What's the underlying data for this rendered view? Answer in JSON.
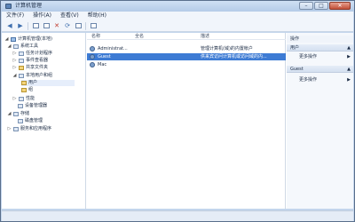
{
  "window": {
    "title": "计算机管理",
    "min_label": "–",
    "max_label": "□",
    "close_label": "✕"
  },
  "menu": [
    "文件(F)",
    "操作(A)",
    "查看(V)",
    "帮助(H)"
  ],
  "toolbar": {
    "icons": [
      "back-icon",
      "forward-icon",
      "properties-icon",
      "list-icon",
      "delete-icon",
      "refresh-icon",
      "export-icon",
      "help-icon"
    ]
  },
  "tree": {
    "root": "计算机管理(本地)",
    "system_tools": "系统工具",
    "task_scheduler": "任务计划程序",
    "event_viewer": "事件查看器",
    "shared_folders": "共享文件夹",
    "local_users_groups": "本地用户和组",
    "users": "用户",
    "groups": "组",
    "performance": "性能",
    "device_manager": "设备管理器",
    "storage": "存储",
    "disk_management": "磁盘管理",
    "services_apps": "服务和应用程序"
  },
  "list": {
    "headers": {
      "name": "名称",
      "fullname": "全名",
      "description": "描述"
    },
    "rows": [
      {
        "name": "Administrat...",
        "fullname": "",
        "description": "管理计算机(域)的内置帐户"
      },
      {
        "name": "Guest",
        "fullname": "",
        "description": "供来宾访问计算机或访问域的内..."
      },
      {
        "name": "Mac",
        "fullname": "",
        "description": ""
      }
    ]
  },
  "actions": {
    "title": "操作",
    "group1_title": "用户",
    "group1_more": "更多操作",
    "group2_title": "Guest",
    "group2_more": "更多操作"
  },
  "colors": {
    "selection": "#3d7bd4",
    "accent": "#5b84b8"
  }
}
